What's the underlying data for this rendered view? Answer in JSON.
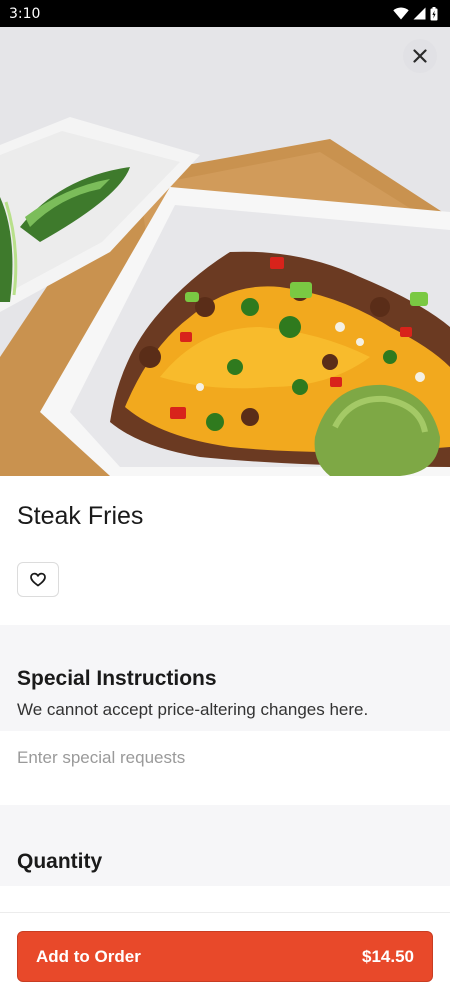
{
  "status_bar": {
    "time": "3:10",
    "icons": [
      "wifi-icon",
      "signal-icon",
      "battery-icon"
    ]
  },
  "hero": {
    "image": "steak fries topped with melted cheese, steak, peppers, cilantro and guacamole in a white bowl on a wooden board",
    "close_icon": "close-icon"
  },
  "item": {
    "title": "Steak Fries",
    "favorite_icon": "heart-icon"
  },
  "special_instructions": {
    "title": "Special Instructions",
    "subtitle": "We cannot accept price-altering changes here.",
    "input_value": "",
    "placeholder": "Enter special requests"
  },
  "quantity": {
    "title": "Quantity"
  },
  "add_to_order": {
    "label": "Add to Order",
    "price": "$14.50"
  },
  "colors": {
    "accent": "#e8492a",
    "section_background": "#f6f6f8",
    "status_bar": "#000000"
  }
}
